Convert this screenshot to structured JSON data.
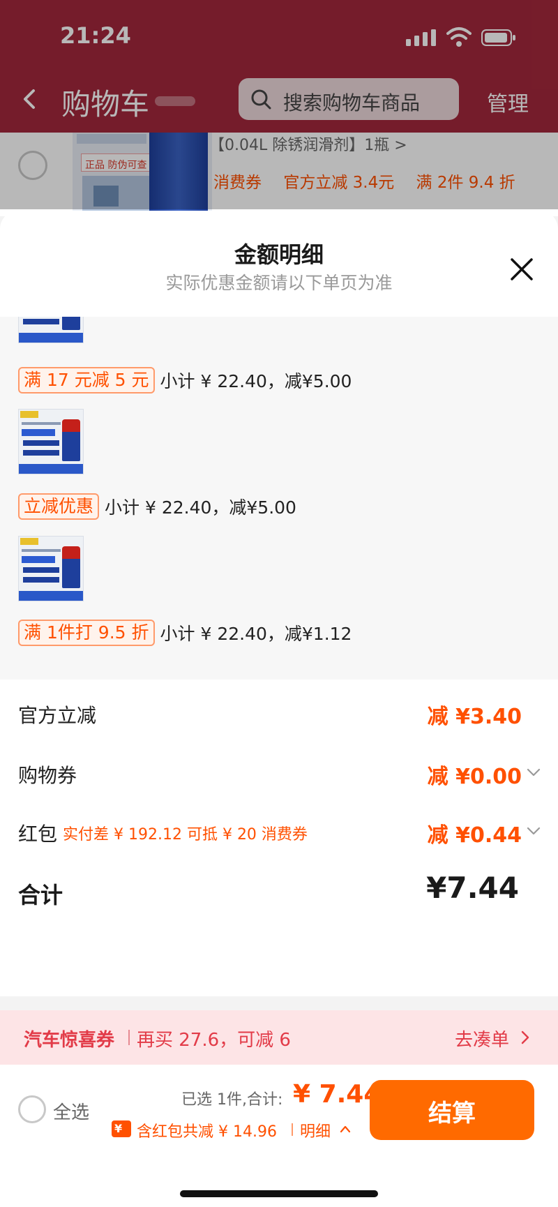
{
  "status_bar": {
    "time": "21:24",
    "icons": [
      "signal-icon",
      "wifi-icon",
      "battery-icon"
    ]
  },
  "nav": {
    "title": "购物车",
    "search_placeholder": "搜索购物车商品",
    "manage_label": "管理"
  },
  "cart_item": {
    "variant": "【0.04L 除锈润滑剂】1瓶 >",
    "thumb_badge": "正品 防伪可查",
    "tags": [
      "消费券",
      "官方立减 3.4元",
      "满 2件 9.4 折"
    ]
  },
  "sheet": {
    "title": "金额明细",
    "subtitle": "实际优惠金额请以下单页为准",
    "promos": [
      {
        "tag": "满 17 元减 5 元",
        "subtotal": "小计 ¥ 22.40，减¥5.00"
      },
      {
        "tag": "立减优惠",
        "subtotal": "小计 ¥ 22.40，减¥5.00"
      },
      {
        "tag": "满 1件打 9.5 折",
        "subtotal": "小计 ¥ 22.40，减¥1.12"
      }
    ],
    "summary": [
      {
        "label": "官方立减",
        "note": "",
        "value": "减 ¥3.40"
      },
      {
        "label": "购物券",
        "note": "",
        "value": "减 ¥0.00"
      },
      {
        "label": "红包",
        "note": "实付差 ¥ 192.12 可抵 ¥ 20 消费券",
        "value": "减 ¥0.44"
      }
    ],
    "total_label": "合计",
    "total_value": "¥7.44"
  },
  "banner": {
    "title": "汽车惊喜券",
    "text": "再买 27.6，可减 6",
    "action": "去凑单"
  },
  "bottom_bar": {
    "select_all": "全选",
    "selected_info": "已选 1件,合计:",
    "total": "¥ 7.44",
    "discount_icon_glyph": "¥",
    "discount_text": "含红包共减 ¥ 14.96",
    "detail_label": "明细",
    "checkout_label": "结算"
  },
  "colors": {
    "header_bg": "#a3283c",
    "accent": "#ff5000",
    "checkout": "#ff6a00",
    "banner_bg": "#fde4e6",
    "banner_text": "#e23b48"
  }
}
